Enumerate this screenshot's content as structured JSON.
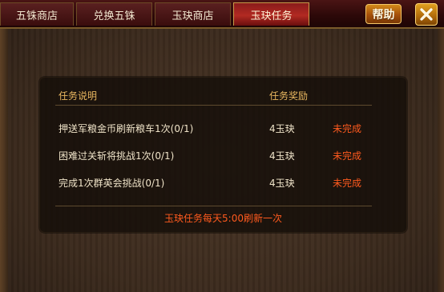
{
  "tabs": [
    {
      "label": "五铢商店",
      "active": false
    },
    {
      "label": "兑换五铢",
      "active": false
    },
    {
      "label": "玉玦商店",
      "active": false
    },
    {
      "label": "玉玦任务",
      "active": true
    }
  ],
  "help_label": "帮助",
  "close_icon": "close-icon",
  "table": {
    "header_desc": "任务说明",
    "header_reward": "任务奖励",
    "rows": [
      {
        "desc": "押送军粮金币刷新粮车1次(0/1)",
        "reward": "4玉玦",
        "status": "未完成"
      },
      {
        "desc": "困难过关斩将挑战1次(0/1)",
        "reward": "4玉玦",
        "status": "未完成"
      },
      {
        "desc": "完成1次群英会挑战(0/1)",
        "reward": "4玉玦",
        "status": "未完成"
      }
    ],
    "footnote": "玉玦任务每天5:00刷新一次"
  },
  "colors": {
    "status": "#ff5a1e",
    "header": "#e9b760",
    "active_tab": "#b22a22"
  }
}
